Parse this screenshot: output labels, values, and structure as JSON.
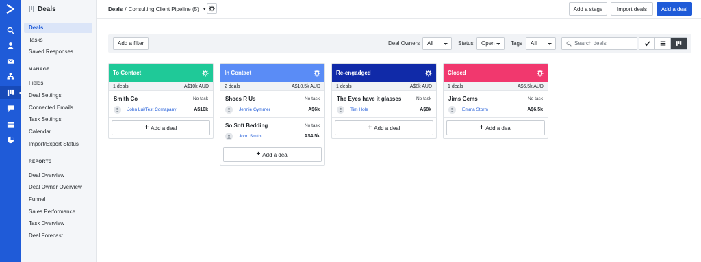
{
  "app": {
    "section_title": "Deals",
    "accent_color": "#1f5bd8"
  },
  "rail": {
    "icons": [
      "logo-chevron-icon",
      "search-icon",
      "contacts-icon",
      "email-icon",
      "automations-icon",
      "deals-icon",
      "conversations-icon",
      "site-icon",
      "reports-icon"
    ]
  },
  "sidebar": {
    "items": [
      {
        "label": "Deals",
        "active": true
      },
      {
        "label": "Tasks"
      },
      {
        "label": "Saved Responses"
      }
    ],
    "manage_heading": "MANAGE",
    "manage_items": [
      "Fields",
      "Deal Settings",
      "Connected Emails",
      "Task Settings",
      "Calendar",
      "Import/Export Status"
    ],
    "reports_heading": "REPORTS",
    "reports_items": [
      "Deal Overview",
      "Deal Owner Overview",
      "Funnel",
      "Sales Performance",
      "Task Overview",
      "Deal Forecast"
    ]
  },
  "header": {
    "breadcrumb_root": "Deals",
    "breadcrumb_sep": "/",
    "pipeline": "Consulting Client Pipeline (5)",
    "add_stage": "Add a stage",
    "import_deals": "Import deals",
    "add_deal": "Add a deal"
  },
  "filters": {
    "add_filter": "Add a filter",
    "owners_label": "Deal Owners",
    "owners_value": "All",
    "status_label": "Status",
    "status_value": "Open",
    "tags_label": "Tags",
    "tags_value": "All",
    "search_placeholder": "Search deals"
  },
  "stages": [
    {
      "name": "To Contact",
      "color": "#1fc998",
      "count": "1 deals",
      "total": "A$10k AUD",
      "deals": [
        {
          "name": "Smith Co",
          "task": "No task",
          "owner": "John Lui/Test Comapany",
          "value": "A$10k"
        }
      ]
    },
    {
      "name": "In Contact",
      "color": "#5a8cf6",
      "count": "2 deals",
      "total": "A$10.5k AUD",
      "deals": [
        {
          "name": "Shoes R Us",
          "task": "No task",
          "owner": "Jennie Gymmer",
          "value": "A$6k"
        },
        {
          "name": "So Soft Bedding",
          "task": "No task",
          "owner": "John Smith",
          "value": "A$4.5k"
        }
      ]
    },
    {
      "name": "Re-engadged",
      "color": "#102aa8",
      "count": "1 deals",
      "total": "A$8k AUD",
      "deals": [
        {
          "name": "The Eyes have it glasses",
          "task": "No task",
          "owner": "Tim Hole",
          "value": "A$8k"
        }
      ]
    },
    {
      "name": "Closed",
      "color": "#f1386e",
      "count": "1 deals",
      "total": "A$6.5k AUD",
      "deals": [
        {
          "name": "Jims Gems",
          "task": "No task",
          "owner": "Emma Storm",
          "value": "A$6.5k"
        }
      ]
    }
  ],
  "board": {
    "add_deal_label": "Add a deal"
  }
}
